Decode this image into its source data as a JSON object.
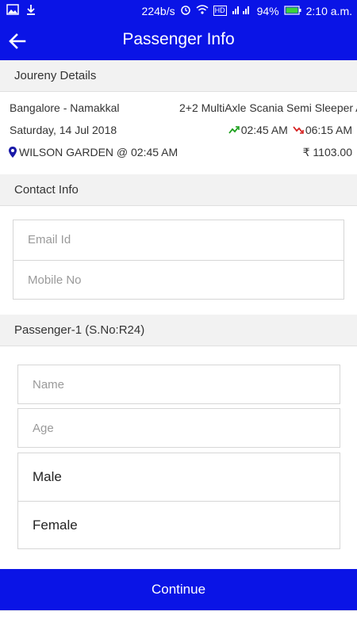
{
  "status_bar": {
    "speed": "224b/s",
    "battery": "94%",
    "time": "2:10 a.m."
  },
  "app_bar": {
    "title": "Passenger Info"
  },
  "journey": {
    "section_title": "Joureny Details",
    "route": "Bangalore - Namakkal",
    "bus_type": "2+2 MultiAxle Scania Semi Sleeper A",
    "date": "Saturday, 14 Jul 2018",
    "departure": "02:45 AM",
    "arrival": "06:15 AM",
    "boarding_point": "WILSON GARDEN @ 02:45 AM",
    "fare": "₹ 1103.00"
  },
  "contact": {
    "section_title": "Contact Info",
    "email_placeholder": "Email Id",
    "mobile_placeholder": "Mobile No"
  },
  "passenger": {
    "section_title": "Passenger-1 (S.No:R24)",
    "name_placeholder": "Name",
    "age_placeholder": "Age",
    "gender_options": [
      "Male",
      "Female"
    ]
  },
  "footer": {
    "continue_label": "Continue"
  },
  "colors": {
    "primary": "#0a14e6",
    "departure_arrow": "#1a9e1a",
    "arrival_arrow": "#d62020",
    "location_pin": "#1a1aa8"
  }
}
